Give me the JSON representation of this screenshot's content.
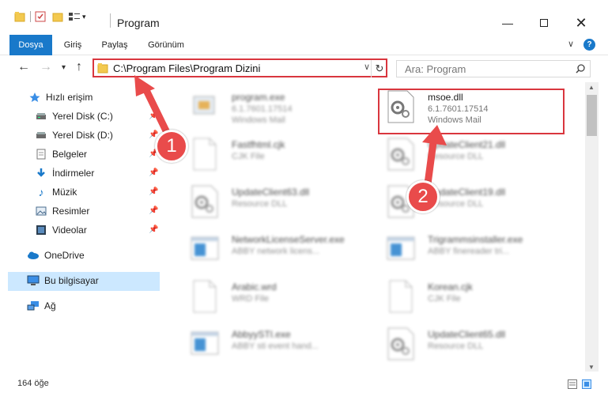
{
  "window": {
    "title": "Program"
  },
  "ribbon": {
    "tabs": [
      {
        "label": "Dosya",
        "active": true
      },
      {
        "label": "Giriş"
      },
      {
        "label": "Paylaş"
      },
      {
        "label": "Görünüm"
      }
    ]
  },
  "address": {
    "path": "C:\\Program Files\\Program Dizini"
  },
  "search": {
    "placeholder": "Ara: Program"
  },
  "sidebar": {
    "items": [
      {
        "label": "Hızlı erişim",
        "icon": "star-icon"
      },
      {
        "label": "Yerel Disk (C:)",
        "icon": "drive-icon"
      },
      {
        "label": "Yerel Disk (D:)",
        "icon": "drive-icon"
      },
      {
        "label": "Belgeler",
        "icon": "documents-icon"
      },
      {
        "label": "İndirmeler",
        "icon": "download-icon"
      },
      {
        "label": "Müzik",
        "icon": "music-icon"
      },
      {
        "label": "Resimler",
        "icon": "pictures-icon"
      },
      {
        "label": "Videolar",
        "icon": "videos-icon"
      },
      {
        "label": "OneDrive",
        "icon": "cloud-icon"
      },
      {
        "label": "Bu bilgisayar",
        "icon": "computer-icon"
      },
      {
        "label": "Ağ",
        "icon": "network-icon"
      }
    ]
  },
  "files": [
    {
      "name": "program.exe",
      "line1": "6.1.7601.17514",
      "line2": "Windows Mail",
      "blurred": true
    },
    {
      "name": "msoe.dll",
      "line1": "6.1.7601.17514",
      "line2": "Windows Mail",
      "blurred": false
    },
    {
      "name": "Fastfhtml.cjk",
      "line1": "CJK File",
      "blurred": true
    },
    {
      "name": "UpdateClient21.dll",
      "line1": "Resource DLL",
      "blurred": true
    },
    {
      "name": "UpdateClient63.dll",
      "line1": "Resource DLL",
      "blurred": true
    },
    {
      "name": "UpdateClient19.dll",
      "line1": "Resource DLL",
      "blurred": true
    },
    {
      "name": "NetworkLicenseServer.exe",
      "line1": "ABBY network licens...",
      "blurred": true
    },
    {
      "name": "Trigrammsinstaller.exe",
      "line1": "ABBY finereader tri...",
      "blurred": true
    },
    {
      "name": "Arabic.wrd",
      "line1": "WRD File",
      "blurred": true
    },
    {
      "name": "Korean.cjk",
      "line1": "CJK File",
      "blurred": true
    },
    {
      "name": "AbbyySTI.exe",
      "line1": "ABBY sti event hand...",
      "blurred": true
    },
    {
      "name": "UpdateClient65.dll",
      "line1": "Resource DLL",
      "blurred": true
    }
  ],
  "status": {
    "item_count": "164 öğe"
  },
  "annotations": [
    {
      "number": "1"
    },
    {
      "number": "2"
    }
  ],
  "colors": {
    "accent": "#1979ca",
    "highlight": "#d9363e",
    "badge": "#e94b4b",
    "selection": "#cce8ff"
  }
}
